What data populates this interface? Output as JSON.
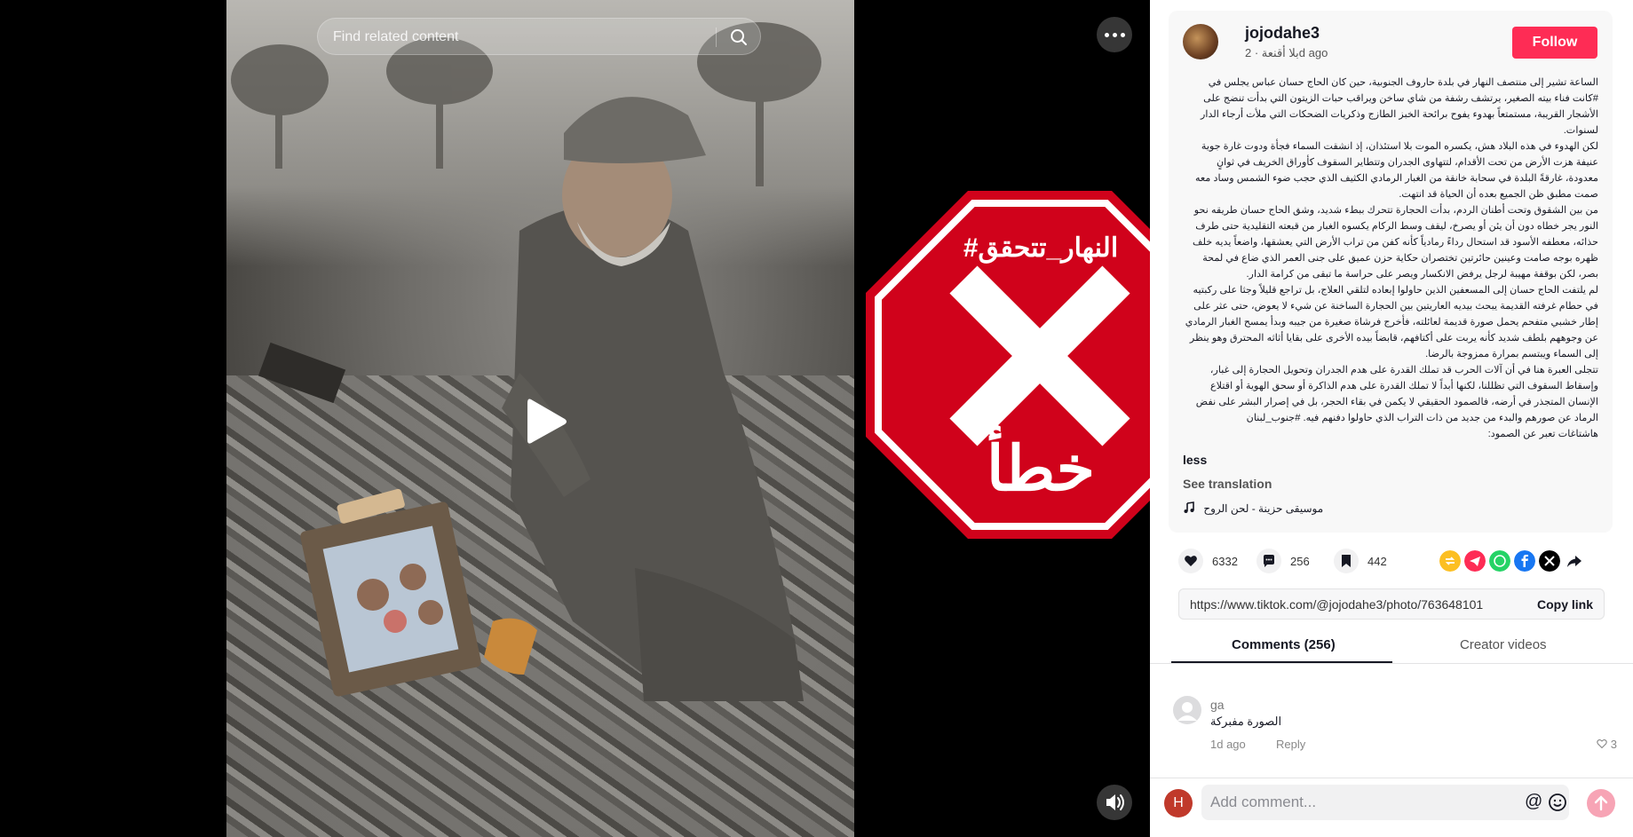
{
  "search": {
    "placeholder": "Find related content"
  },
  "overlay": {
    "hashtag": "#النهار_تتحقق",
    "verdict": "خطأ",
    "color": "#d0021b"
  },
  "post": {
    "username": "jojodahe3",
    "meta": "بلا أقنعة · 2d ago",
    "follow_label": "Follow",
    "description": [
      "الساعة تشير إلى منتصف النهار في بلدة حاروف الجنوبية، حين كان الحاج حسان عباس يجلس في #كانت فناء بيته الصغير، يرتشف رشفة من شاي ساخن ويراقب حبات الزيتون التي بدأت تنضج على الأشجار القريبة، مستمتعاً بهدوء يفوح برائحة الخبز الطازج وذكريات الضحكات التي ملأت أرجاء الدار لسنوات.",
      "لكن الهدوء في هذه البلاد هش، يكسره الموت بلا استئذان، إذ انشقت السماء فجأة ودوت غارة جوية عنيفة هزت الأرض من تحت الأقدام، لتتهاوى الجدران وتتطاير السقوف كأوراق الخريف في ثوانٍ معدودة، غارقةً البلدة في سحابة خانقة من الغبار الرمادي الكثيف الذي حجب ضوء الشمس وساد معه صمت مطبق ظن الجميع بعده أن الحياة قد انتهت.",
      "من بين الشقوق وتحت أطنان الردم، بدأت الحجارة تتحرك ببطء شديد، وشق الحاج حسان طريقه نحو النور يجر خطاه دون أن يئن أو يصرخ، ليقف وسط الركام يكسوه الغبار من قبعته التقليدية حتى طرف حذائه، معطفه الأسود قد استحال رداءً رمادياً كأنه كفن من تراب الأرض التي يعشقها، واضعاً يديه خلف ظهره بوجه صامت وعينين حائرتين تختصران حكاية حزن عميق على جنى العمر الذي ضاع في لمحة بصر، لكن بوقفة مهيبة لرجل يرفض الانكسار ويصر على حراسة ما تبقى من كرامة الدار.",
      "لم يلتفت الحاج حسان إلى المسعفين الذين حاولوا إبعاده لتلقي العلاج، بل تراجع قليلاً وجثا على ركبتيه في حطام غرفته القديمة يبحث بيديه العاريتين بين الحجارة الساخنة عن شيء لا يعوض، حتى عثر على إطار خشبي متفحم يحمل صورة قديمة لعائلته، فأخرج فرشاة صغيرة من جيبه وبدأ يمسح الغبار الرمادي عن وجوههم بلطف شديد كأنه يربت على أكتافهم، قابضاً بيده الأخرى على بقايا أثاثه المحترق وهو ينظر إلى السماء ويبتسم بمرارة ممزوجة بالرضا.",
      "تتجلى العبرة هنا في أن آلات الحرب قد تملك القدرة على هدم الجدران وتحويل الحجارة إلى غبار، وإسقاط السقوف التي تظللنا، لكنها أبداً لا تملك القدرة على هدم الذاكرة أو سحق الهوية أو اقتلاع الإنسان المتجذر في أرضه، فالصمود الحقيقي لا يكمن في بقاء الحجر، بل في إصرار البشر على نفض الرماد عن صورهم والبدء من جديد من ذات التراب الذي حاولوا دفنهم فيه. #جنوب_لبنان",
      "هاشتاغات تعبر عن الصمود:"
    ],
    "truncated": "less",
    "see_translation": "See translation",
    "music": "موسيقى حزينة - لحن الروح"
  },
  "actions": {
    "likes": "6332",
    "comments": "256",
    "saves": "442",
    "share_icons": [
      "repost-icon",
      "telegram-icon",
      "whatsapp-icon",
      "facebook-icon",
      "x-icon",
      "share-arrow-icon"
    ]
  },
  "link": {
    "url": "https://www.tiktok.com/@jojodahe3/photo/763648101...",
    "copy_label": "Copy link"
  },
  "tabs": {
    "comments": "Comments (256)",
    "creator": "Creator videos"
  },
  "comment": {
    "user": "ga",
    "text": "الصورة مفبركة",
    "time": "1d ago",
    "reply": "Reply",
    "likes": "3"
  },
  "composer": {
    "avatar_letter": "H",
    "placeholder": "Add comment..."
  }
}
